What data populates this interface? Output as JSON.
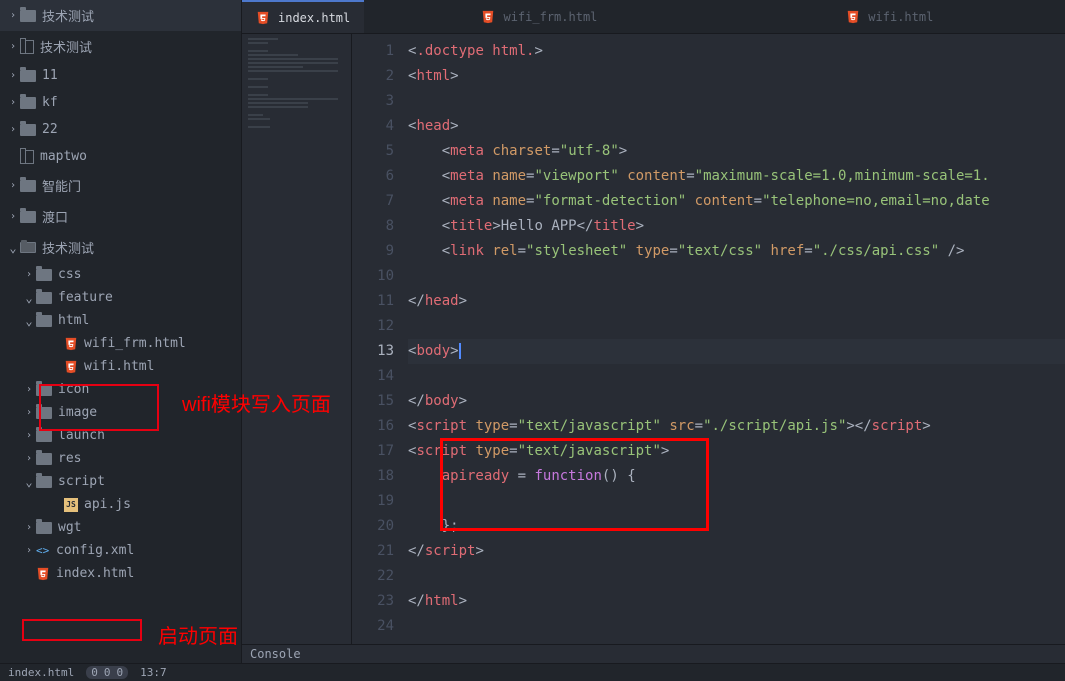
{
  "sidebar": {
    "items": [
      {
        "indent": 8,
        "chev": "collapsed",
        "icon": "folder",
        "label": "技术测试"
      },
      {
        "indent": 8,
        "chev": "collapsed",
        "icon": "repo",
        "label": "技术测试"
      },
      {
        "indent": 8,
        "chev": "collapsed",
        "icon": "folder",
        "label": "11"
      },
      {
        "indent": 8,
        "chev": "collapsed",
        "icon": "folder",
        "label": "kf"
      },
      {
        "indent": 8,
        "chev": "collapsed",
        "icon": "folder",
        "label": "22"
      },
      {
        "indent": 8,
        "chev": "",
        "icon": "repo",
        "label": "maptwo"
      },
      {
        "indent": 8,
        "chev": "collapsed",
        "icon": "folder",
        "label": "智能门"
      },
      {
        "indent": 8,
        "chev": "collapsed",
        "icon": "folder",
        "label": "渡口"
      },
      {
        "indent": 8,
        "chev": "expanded",
        "icon": "folder-open",
        "label": "技术测试"
      },
      {
        "indent": 24,
        "chev": "collapsed",
        "icon": "folder",
        "label": "css"
      },
      {
        "indent": 24,
        "chev": "expanded",
        "icon": "folder",
        "label": "feature"
      },
      {
        "indent": 24,
        "chev": "expanded",
        "icon": "folder",
        "label": "html"
      },
      {
        "indent": 52,
        "chev": "",
        "icon": "html",
        "label": "wifi_frm.html"
      },
      {
        "indent": 52,
        "chev": "",
        "icon": "html",
        "label": "wifi.html"
      },
      {
        "indent": 24,
        "chev": "collapsed",
        "icon": "folder",
        "label": "icon"
      },
      {
        "indent": 24,
        "chev": "collapsed",
        "icon": "folder",
        "label": "image"
      },
      {
        "indent": 24,
        "chev": "collapsed",
        "icon": "folder",
        "label": "launch"
      },
      {
        "indent": 24,
        "chev": "collapsed",
        "icon": "folder",
        "label": "res"
      },
      {
        "indent": 24,
        "chev": "expanded",
        "icon": "folder",
        "label": "script"
      },
      {
        "indent": 52,
        "chev": "",
        "icon": "js",
        "label": "api.js"
      },
      {
        "indent": 24,
        "chev": "collapsed",
        "icon": "folder",
        "label": "wgt"
      },
      {
        "indent": 24,
        "chev": "collapsed",
        "icon": "xml",
        "label": "config.xml"
      },
      {
        "indent": 24,
        "chev": "",
        "icon": "html",
        "label": "index.html"
      }
    ]
  },
  "annotations": {
    "wifi_module": "wifi模块写入页面",
    "startup_page": "启动页面"
  },
  "tabs": [
    {
      "icon": "html",
      "label": "index.html",
      "active": true
    },
    {
      "icon": "html",
      "label": "wifi_frm.html",
      "active": false
    },
    {
      "icon": "html",
      "label": "wifi.html",
      "active": false
    }
  ],
  "editor": {
    "lines": [
      {
        "n": 1,
        "html": "<span class='tk-punct'>&lt;</span><span class='tk-tag'>.doctype html.</span><span class='tk-punct'>&gt;</span>"
      },
      {
        "n": 2,
        "html": "<span class='tk-punct'>&lt;</span><span class='tk-tag'>html</span><span class='tk-punct'>&gt;</span>"
      },
      {
        "n": 3,
        "html": ""
      },
      {
        "n": 4,
        "html": "<span class='tk-punct'>&lt;</span><span class='tk-tag'>head</span><span class='tk-punct'>&gt;</span>"
      },
      {
        "n": 5,
        "html": "    <span class='tk-punct'>&lt;</span><span class='tk-tag'>meta</span> <span class='tk-attr'>charset</span><span class='tk-punct'>=</span><span class='tk-str'>\"utf-8\"</span><span class='tk-punct'>&gt;</span>"
      },
      {
        "n": 6,
        "html": "    <span class='tk-punct'>&lt;</span><span class='tk-tag'>meta</span> <span class='tk-attr'>name</span><span class='tk-punct'>=</span><span class='tk-str'>\"viewport\"</span> <span class='tk-attr'>content</span><span class='tk-punct'>=</span><span class='tk-str'>\"maximum-scale=1.0,minimum-scale=1.</span>"
      },
      {
        "n": 7,
        "html": "    <span class='tk-punct'>&lt;</span><span class='tk-tag'>meta</span> <span class='tk-attr'>name</span><span class='tk-punct'>=</span><span class='tk-str'>\"format-detection\"</span> <span class='tk-attr'>content</span><span class='tk-punct'>=</span><span class='tk-str'>\"telephone=no,email=no,date</span>"
      },
      {
        "n": 8,
        "html": "    <span class='tk-punct'>&lt;</span><span class='tk-tag'>title</span><span class='tk-punct'>&gt;</span><span class='tk-text'>Hello APP</span><span class='tk-punct'>&lt;/</span><span class='tk-tag'>title</span><span class='tk-punct'>&gt;</span>"
      },
      {
        "n": 9,
        "html": "    <span class='tk-punct'>&lt;</span><span class='tk-tag'>link</span> <span class='tk-attr'>rel</span><span class='tk-punct'>=</span><span class='tk-str'>\"stylesheet\"</span> <span class='tk-attr'>type</span><span class='tk-punct'>=</span><span class='tk-str'>\"text/css\"</span> <span class='tk-attr'>href</span><span class='tk-punct'>=</span><span class='tk-str'>\"./css/api.css\"</span> <span class='tk-punct'>/&gt;</span>"
      },
      {
        "n": 10,
        "html": ""
      },
      {
        "n": 11,
        "html": "<span class='tk-punct'>&lt;/</span><span class='tk-tag'>head</span><span class='tk-punct'>&gt;</span>"
      },
      {
        "n": 12,
        "html": ""
      },
      {
        "n": 13,
        "html": "<span class='tk-punct'>&lt;</span><span class='tk-tag'>body</span><span class='tk-punct'>&gt;</span><span class='cursor'></span>",
        "active": true
      },
      {
        "n": 14,
        "html": ""
      },
      {
        "n": 15,
        "html": "<span class='tk-punct'>&lt;/</span><span class='tk-tag'>body</span><span class='tk-punct'>&gt;</span>"
      },
      {
        "n": 16,
        "html": "<span class='tk-punct'>&lt;</span><span class='tk-tag'>script</span> <span class='tk-attr'>type</span><span class='tk-punct'>=</span><span class='tk-str'>\"text/javascript\"</span> <span class='tk-attr'>src</span><span class='tk-punct'>=</span><span class='tk-str'>\"./script/api.js\"</span><span class='tk-punct'>&gt;&lt;/</span><span class='tk-tag'>script</span><span class='tk-punct'>&gt;</span>"
      },
      {
        "n": 17,
        "html": "<span class='tk-punct'>&lt;</span><span class='tk-tag'>script</span> <span class='tk-attr'>type</span><span class='tk-punct'>=</span><span class='tk-str'>\"text/javascript\"</span><span class='tk-punct'>&gt;</span>"
      },
      {
        "n": 18,
        "html": "    <span class='tk-var'>apiready</span> <span class='tk-punct'>=</span> <span class='tk-keyword'>function</span><span class='tk-punct'>() {</span>"
      },
      {
        "n": 19,
        "html": ""
      },
      {
        "n": 20,
        "html": "    <span class='tk-punct'>};</span>"
      },
      {
        "n": 21,
        "html": "<span class='tk-punct'>&lt;/</span><span class='tk-tag'>script</span><span class='tk-punct'>&gt;</span>"
      },
      {
        "n": 22,
        "html": ""
      },
      {
        "n": 23,
        "html": "<span class='tk-punct'>&lt;/</span><span class='tk-tag'>html</span><span class='tk-punct'>&gt;</span>"
      },
      {
        "n": 24,
        "html": ""
      }
    ]
  },
  "bottom_panel": {
    "label": "Console"
  },
  "statusbar": {
    "file": "index.html",
    "git": [
      "0",
      "0",
      "0"
    ],
    "cursor": "13:7"
  }
}
